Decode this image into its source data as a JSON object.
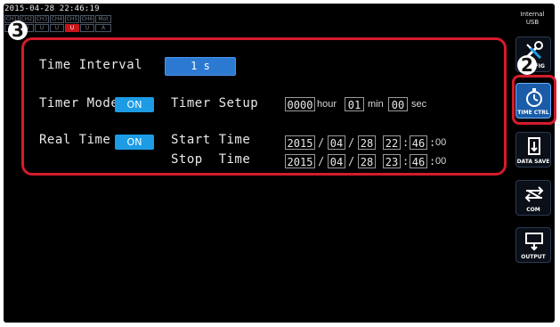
{
  "status": {
    "datetime": "2015-04-28 22:46:19",
    "channels_row1": [
      "CH1",
      "CH2",
      "CH3",
      "CH4",
      "CH5",
      "CH6",
      "Mot"
    ],
    "channels_row2": [
      "U",
      "U",
      "U",
      "U",
      "U",
      "U",
      "A"
    ],
    "alarm_color": "#c8151b"
  },
  "storage": {
    "line1": "Internal",
    "line2": "USB"
  },
  "menu": {
    "items": [
      {
        "label": "CONFIG",
        "icon": "wrench-screwdriver-icon",
        "active": false
      },
      {
        "label": "TIME CTRL",
        "icon": "stopwatch-icon",
        "active": true
      },
      {
        "label": "DATA SAVE",
        "icon": "usb-save-icon",
        "active": false
      },
      {
        "label": "COM",
        "icon": "communication-arrows-icon",
        "active": false
      },
      {
        "label": "OUTPUT",
        "icon": "output-icon",
        "active": false
      }
    ]
  },
  "callouts": {
    "settings": "3",
    "menu": "2"
  },
  "time_interval": {
    "label": "Time Interval",
    "value": "1 s"
  },
  "timer": {
    "mode_label": "Timer Mode",
    "mode_value": "ON",
    "setup_label": "Timer Setup",
    "hour": "0000",
    "hour_unit": "hour",
    "min": "01",
    "min_unit": "min",
    "sec": "00",
    "sec_unit": "sec"
  },
  "real_time": {
    "label": "Real Time",
    "value": "ON",
    "start_label": "Start Time",
    "start": {
      "year": "2015",
      "month": "04",
      "day": "28",
      "hour": "22",
      "minute": "46",
      "second": "00"
    },
    "stop_label": "Stop  Time",
    "stop": {
      "year": "2015",
      "month": "04",
      "day": "28",
      "hour": "23",
      "minute": "46",
      "second": "00"
    }
  },
  "colors": {
    "accent_red": "#d51b2b",
    "button_blue": "#2c79d2",
    "on_blue": "#1d9ce5",
    "active_menu": "#1b5ca8"
  }
}
